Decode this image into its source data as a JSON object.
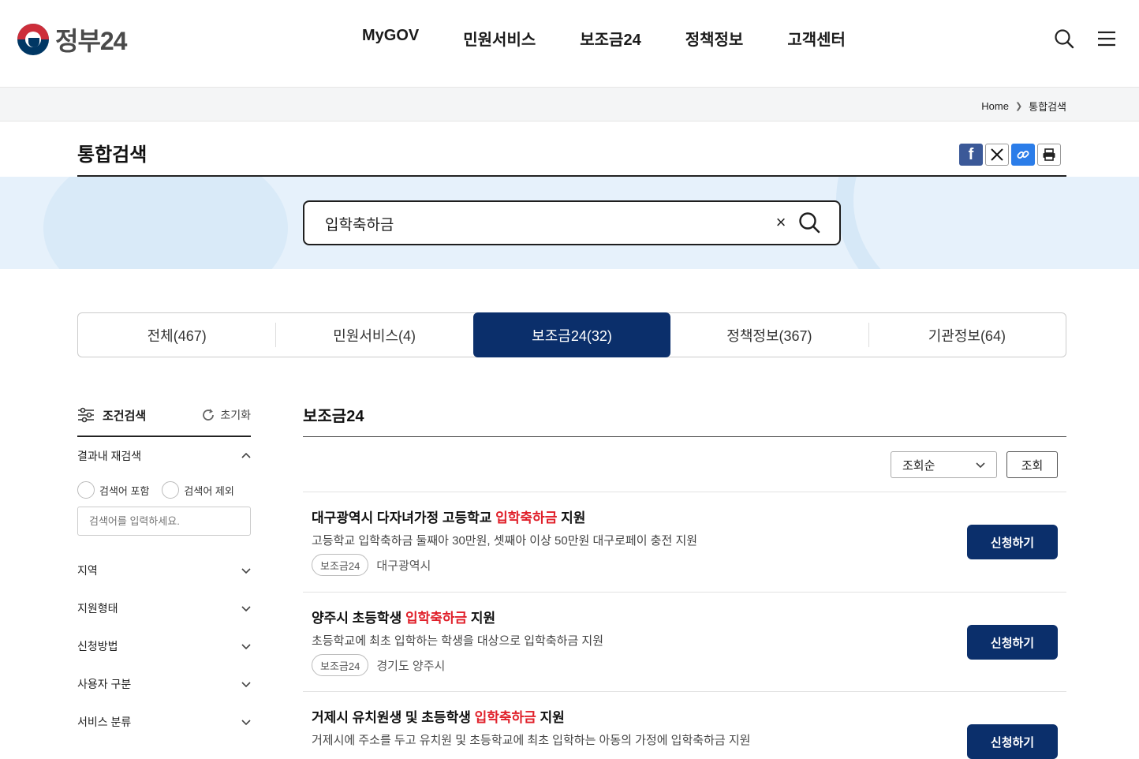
{
  "header": {
    "logo_text": "정부24",
    "nav": [
      "MyGOV",
      "민원서비스",
      "보조금24",
      "정책정보",
      "고객센터"
    ],
    "icons": [
      "search-icon",
      "hamburger-menu-icon"
    ]
  },
  "breadcrumb": {
    "home": "Home",
    "current": "통합검색"
  },
  "page": {
    "title": "통합검색"
  },
  "share": {
    "icons": [
      "facebook-icon",
      "x-icon",
      "link-icon",
      "print-icon"
    ]
  },
  "search": {
    "value": "입학축하금",
    "clear": "×"
  },
  "tabs": [
    {
      "label": "전체(467)",
      "active": false
    },
    {
      "label": "민원서비스(4)",
      "active": false
    },
    {
      "label": "보조금24(32)",
      "active": true
    },
    {
      "label": "정책정보(367)",
      "active": false
    },
    {
      "label": "기관정보(64)",
      "active": false
    }
  ],
  "sidebar": {
    "title": "조건검색",
    "reset": "초기화",
    "research_label": "결과내 재검색",
    "radio_include": "검색어 포함",
    "radio_exclude": "검색어 제외",
    "keyword_placeholder": "검색어를 입력하세요.",
    "filters": [
      "지역",
      "지원형태",
      "신청방법",
      "사용자 구분",
      "서비스 분류"
    ]
  },
  "results": {
    "section_title": "보조금24",
    "sort_value": "조회순",
    "sort_button": "조회",
    "items": [
      {
        "title_pre": "대구광역시 다자녀가정 고등학교 ",
        "title_hl": "입학축하금",
        "title_post": " 지원",
        "desc": "고등학교 입학축하금 둘째아 30만원, 셋째아 이상 50만원 대구로페이 충전 지원",
        "badge": "보조금24",
        "region": "대구광역시",
        "apply": "신청하기"
      },
      {
        "title_pre": "양주시 초등학생 ",
        "title_hl": "입학축하금",
        "title_post": " 지원",
        "desc": "초등학교에 최초 입학하는 학생을 대상으로 입학축하금 지원",
        "badge": "보조금24",
        "region": "경기도 양주시",
        "apply": "신청하기"
      },
      {
        "title_pre": "거제시 유치원생 및 초등학생 ",
        "title_hl": "입학축하금",
        "title_post": " 지원",
        "desc": "거제시에 주소를 두고 유치원 및 초등학교에 최초 입학하는 아동의 가정에 입학축하금 지원",
        "badge": "",
        "region": "",
        "apply": "신청하기"
      }
    ]
  }
}
